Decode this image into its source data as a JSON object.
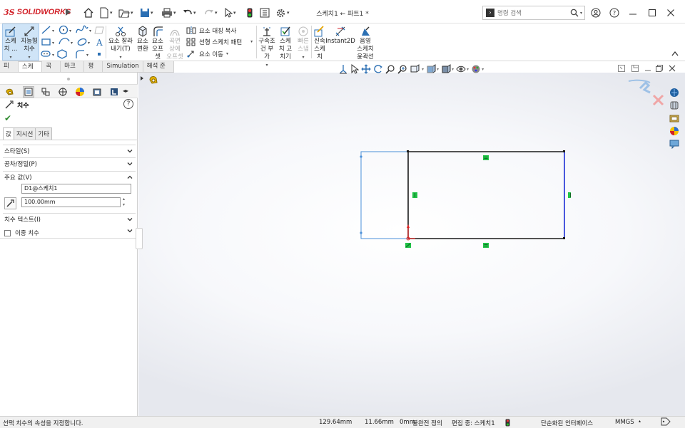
{
  "app": {
    "brand_ds": "3S",
    "brand_name": "SOLIDWORKS",
    "document_title": "스케치1 ← 파트1 *"
  },
  "search": {
    "placeholder": "명령 검색",
    "prompt_symbol": "›"
  },
  "ribbon": {
    "active_tool_label_1": "스케",
    "active_tool_label_2": "치 ...",
    "smart_dim_label_1": "지능형",
    "smart_dim_label_2": "치수",
    "trim_label_1": "요소 잘라",
    "trim_label_2": "내기(T)",
    "convert_label_1": "요소",
    "convert_label_2": "변환",
    "offset_label_1": "요소",
    "offset_label_2": "오프",
    "offset_label_3": "셋",
    "surface_offset_1": "곡면",
    "surface_offset_2": "상에",
    "surface_offset_3": "오프셋",
    "mirror": "요소 대칭 복사",
    "linear_pattern": "선형 스케치 패턴",
    "move": "요소 이동",
    "relations_1": "구속조",
    "relations_2": "건 부가",
    "repair_1": "스케",
    "repair_2": "치 고",
    "repair_3": "치기",
    "quick_snap_1": "빠른",
    "quick_snap_2": "스냅",
    "rapid_1": "신속",
    "rapid_2": "스케",
    "rapid_3": "치",
    "instant2d": "Instant2D",
    "shaded_1": "음영",
    "shaded_2": "스케치",
    "shaded_3": "윤곽선"
  },
  "tabs": [
    {
      "label": "피처"
    },
    {
      "label": "스케치"
    },
    {
      "label": "곡면"
    },
    {
      "label": "마크업"
    },
    {
      "label": "평가"
    },
    {
      "label": "Simulation"
    },
    {
      "label": "해석 준비"
    }
  ],
  "property_manager": {
    "title": "치수",
    "subtabs": [
      "값",
      "지시선",
      "기타"
    ],
    "groups": {
      "style": "스타일(S)",
      "tolerance": "공차/정밀(P)",
      "primary_value": "주요 값(V)",
      "dim_text": "치수 텍스트(I)",
      "dual_dim": "이중 치수"
    },
    "dim_name": "D1@스케치1",
    "dim_value": "100.00mm",
    "help": "?"
  },
  "status_bar": {
    "message": "선택 치수의 속성을 지정합니다.",
    "x": "129.64mm",
    "y": "11.66mm",
    "z": "0mm",
    "state": "불완전 정의",
    "editing": "편집 중: 스케치1",
    "ui_mode": "단순화된 인터페이스",
    "units": "MMGS"
  },
  "colors": {
    "accent_red": "#d12028",
    "active_blue": "#cfe4f7",
    "sketch_black": "#1a1a1a",
    "sketch_blue": "#1d2fd6",
    "selected_blue": "#4a90d9",
    "relation_green": "#21c247"
  },
  "icons": [
    "home-icon",
    "new-icon",
    "open-icon",
    "save-icon",
    "print-icon",
    "undo-icon",
    "redo-icon",
    "select-icon",
    "rebuild-icon",
    "file-props-icon",
    "options-icon",
    "user-icon",
    "help-icon"
  ]
}
